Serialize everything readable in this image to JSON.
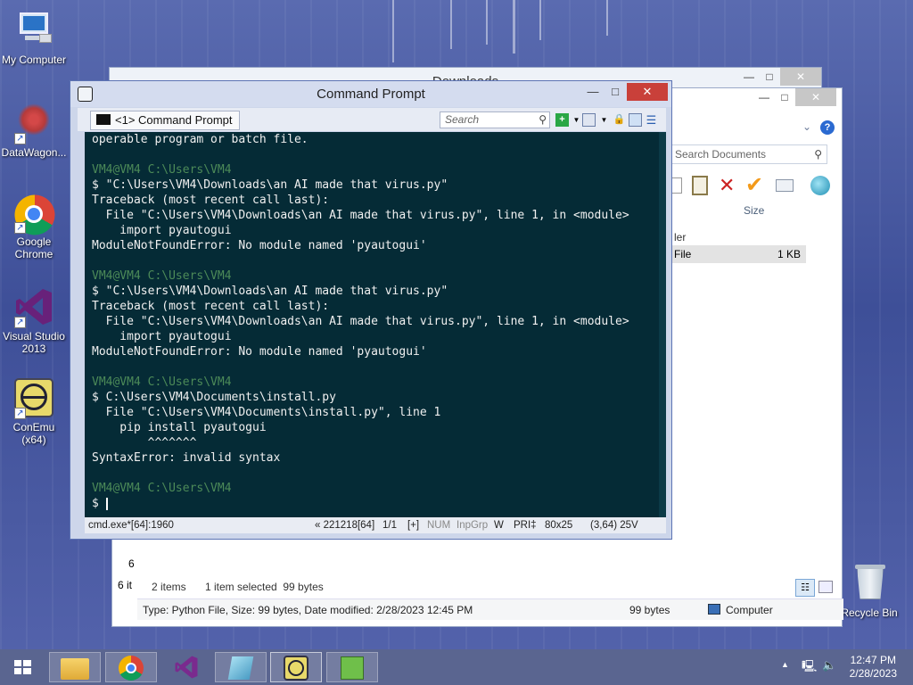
{
  "desktop": {
    "icons": [
      {
        "label": "My Computer",
        "icon": "my-computer-icon"
      },
      {
        "label": "DataWagon...",
        "icon": "datawagon-icon"
      },
      {
        "label": "Google Chrome",
        "icon": "chrome-icon"
      },
      {
        "label": "Visual Studio 2013",
        "icon": "visual-studio-icon"
      },
      {
        "label": "ConEmu (x64)",
        "icon": "conemu-icon"
      },
      {
        "label": "Recycle Bin",
        "icon": "recycle-bin-icon"
      }
    ]
  },
  "explorer_back": {
    "title": "Downloads"
  },
  "explorer": {
    "search_placeholder": "Search Documents",
    "column_size": "Size",
    "partial_folder": "ler",
    "row_type": "File",
    "row_size": "1 KB",
    "status_items": "2 items",
    "status_selected": "1 item selected  99 bytes",
    "details": "Type: Python File, Size: 99 bytes, Date modified: 2/28/2023 12:45 PM",
    "details_size": "99 bytes",
    "details_location": "Computer",
    "partial_left_1": "6",
    "partial_left_2": "6 it"
  },
  "cmd": {
    "title": "Command Prompt",
    "tab_label": "<1> Command Prompt",
    "search_placeholder": "Search",
    "console_lines": [
      {
        "text": "operable program or batch file.",
        "kind": "out"
      },
      {
        "text": "",
        "kind": "out"
      },
      {
        "text": "VM4@VM4 C:\\Users\\VM4",
        "kind": "prompt"
      },
      {
        "text": "$ \"C:\\Users\\VM4\\Downloads\\an AI made that virus.py\"",
        "kind": "out"
      },
      {
        "text": "Traceback (most recent call last):",
        "kind": "out"
      },
      {
        "text": "  File \"C:\\Users\\VM4\\Downloads\\an AI made that virus.py\", line 1, in <module>",
        "kind": "out"
      },
      {
        "text": "    import pyautogui",
        "kind": "out"
      },
      {
        "text": "ModuleNotFoundError: No module named 'pyautogui'",
        "kind": "out"
      },
      {
        "text": "",
        "kind": "out"
      },
      {
        "text": "VM4@VM4 C:\\Users\\VM4",
        "kind": "prompt"
      },
      {
        "text": "$ \"C:\\Users\\VM4\\Downloads\\an AI made that virus.py\"",
        "kind": "out"
      },
      {
        "text": "Traceback (most recent call last):",
        "kind": "out"
      },
      {
        "text": "  File \"C:\\Users\\VM4\\Downloads\\an AI made that virus.py\", line 1, in <module>",
        "kind": "out"
      },
      {
        "text": "    import pyautogui",
        "kind": "out"
      },
      {
        "text": "ModuleNotFoundError: No module named 'pyautogui'",
        "kind": "out"
      },
      {
        "text": "",
        "kind": "out"
      },
      {
        "text": "VM4@VM4 C:\\Users\\VM4",
        "kind": "prompt"
      },
      {
        "text": "$ C:\\Users\\VM4\\Documents\\install.py",
        "kind": "out"
      },
      {
        "text": "  File \"C:\\Users\\VM4\\Documents\\install.py\", line 1",
        "kind": "out"
      },
      {
        "text": "    pip install pyautogui",
        "kind": "out"
      },
      {
        "text": "        ^^^^^^^",
        "kind": "out"
      },
      {
        "text": "SyntaxError: invalid syntax",
        "kind": "out"
      },
      {
        "text": "",
        "kind": "out"
      },
      {
        "text": "VM4@VM4 C:\\Users\\VM4",
        "kind": "prompt"
      },
      {
        "text": "$ ",
        "kind": "input"
      }
    ],
    "status": {
      "process": "cmd.exe*[64]:1960",
      "pid": "« 221218[64]",
      "console": "1/1",
      "plus": "[+]",
      "num": "NUM",
      "inpgrp": "InpGrp",
      "w": "W",
      "pri": "PRI‡",
      "size": "80x25",
      "cursor": "(3,64) 25V"
    }
  },
  "taskbar": {
    "time": "12:47 PM",
    "date": "2/28/2023",
    "items": [
      "file-explorer-icon",
      "chrome-icon",
      "visual-studio-icon",
      "notepad-icon",
      "conemu-icon",
      "notepad-plus-icon"
    ]
  }
}
